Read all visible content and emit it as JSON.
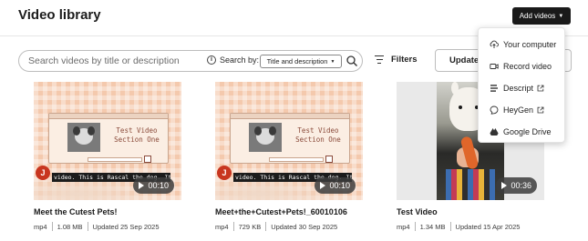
{
  "header": {
    "title": "Video library",
    "add_videos_label": "Add videos"
  },
  "search": {
    "placeholder": "Search videos by title or description",
    "search_by_label": "Search by:",
    "search_by_value": "Title and description"
  },
  "toolbar": {
    "filters_label": "Filters",
    "sort_label": "Updated"
  },
  "add_menu": {
    "items": [
      {
        "label": "Your computer",
        "icon": "upload-icon",
        "external": false
      },
      {
        "label": "Record video",
        "icon": "video-camera-icon",
        "external": false
      },
      {
        "label": "Descript",
        "icon": "descript-icon",
        "external": true
      },
      {
        "label": "HeyGen",
        "icon": "heygen-icon",
        "external": true
      },
      {
        "label": "Google Drive",
        "icon": "google-drive-icon",
        "external": false
      }
    ]
  },
  "videos": [
    {
      "title": "Meet the Cutest Pets!",
      "format": "mp4",
      "size": "1.08 MB",
      "updated": "Updated 25 Sep 2025",
      "duration": "00:10",
      "avatar_initial": "J",
      "slide_title": "Test Video Section One",
      "caption": "video. This is Rascal the dog. It's"
    },
    {
      "title": "Meet+the+Cutest+Pets!_60010106",
      "format": "mp4",
      "size": "729 KB",
      "updated": "Updated 30 Sep 2025",
      "duration": "00:10",
      "avatar_initial": "J",
      "slide_title": "Test Video Section One",
      "caption": "video. This is Rascal the dog. It's"
    },
    {
      "title": "Test Video",
      "format": "mp4",
      "size": "1.34 MB",
      "updated": "Updated 15 Apr 2025",
      "duration": "00:36"
    }
  ],
  "colors": {
    "primary_button": "#1a1a1a",
    "avatar": "#c8361f",
    "thumb_bg": "#f4c9ad"
  }
}
